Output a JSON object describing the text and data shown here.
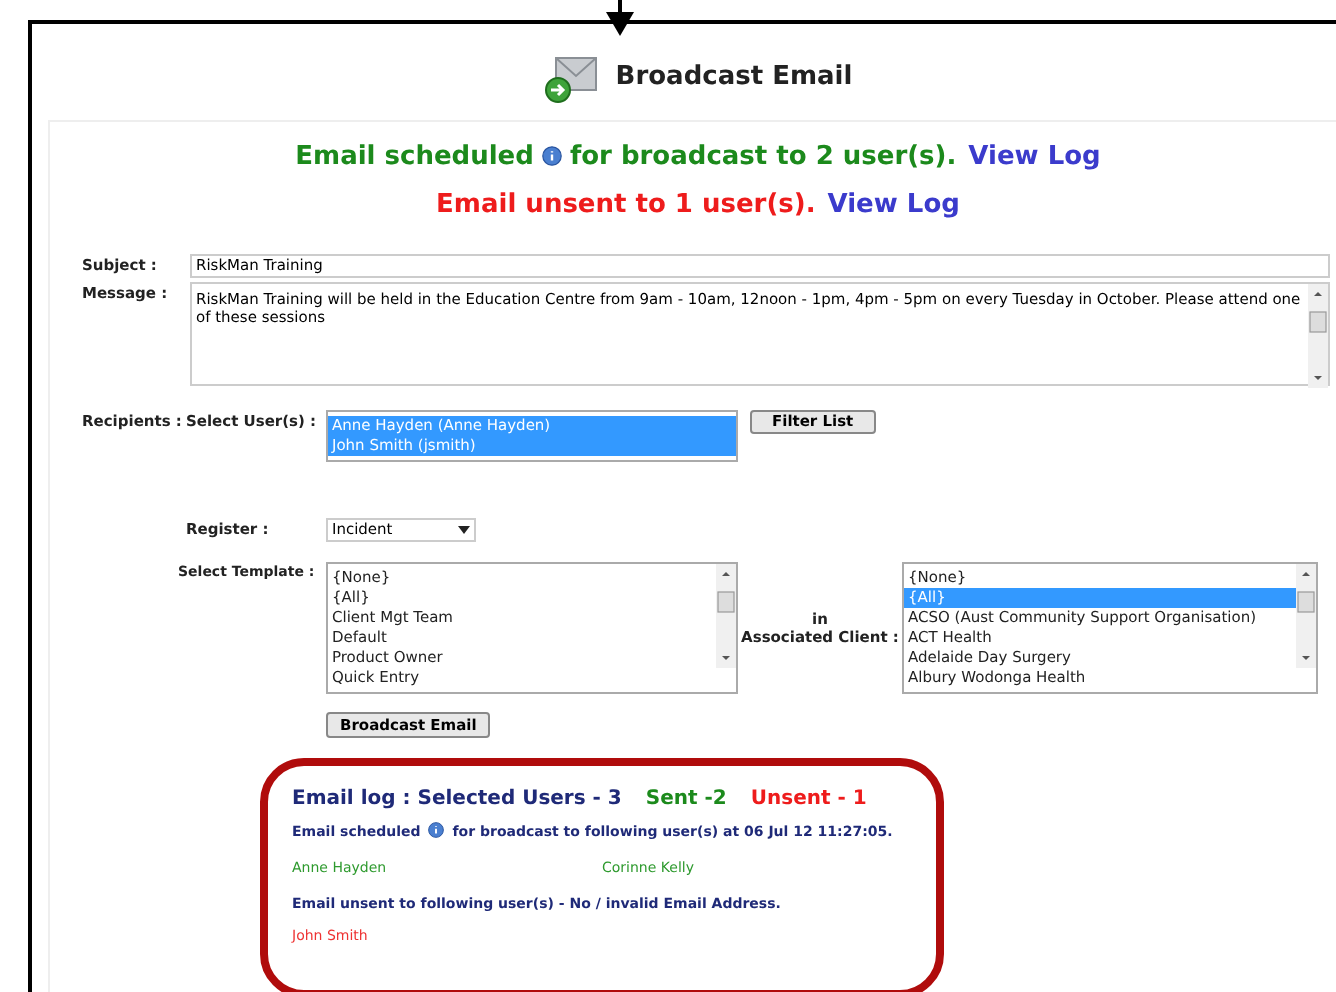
{
  "title": "Broadcast Email",
  "notices": [
    {
      "kind": "success",
      "before": "Email scheduled",
      "after": "for broadcast to 2 user(s).",
      "link": "View Log"
    },
    {
      "kind": "error",
      "before": "Email unsent to 1 user(s).",
      "link": "View Log"
    }
  ],
  "subject": {
    "label": "Subject :",
    "value": "RiskMan Training"
  },
  "message": {
    "label": "Message :",
    "value": "RiskMan Training will be held in the Education Centre from 9am - 10am, 12noon - 1pm, 4pm - 5pm on every Tuesday in October. Please attend one of these sessions"
  },
  "recipients": {
    "label": "Recipients :",
    "select_label": "Select User(s) :",
    "users": [
      {
        "label": "Anne Hayden (Anne Hayden)",
        "selected": true
      },
      {
        "label": "John Smith (jsmith)",
        "selected": true
      }
    ],
    "filter_button": "Filter List"
  },
  "register": {
    "label": "Register :",
    "value": "Incident"
  },
  "template": {
    "label": "Select Template :",
    "items": [
      {
        "label": "{None}",
        "selected": false
      },
      {
        "label": "{All}",
        "selected": false
      },
      {
        "label": "Client Mgt Team",
        "selected": false
      },
      {
        "label": "Default",
        "selected": false
      },
      {
        "label": "Product Owner",
        "selected": false
      },
      {
        "label": "Quick Entry",
        "selected": false
      }
    ]
  },
  "client": {
    "label_top": "in",
    "label": "Associated Client :",
    "items": [
      {
        "label": "{None}",
        "selected": false
      },
      {
        "label": "{All}",
        "selected": true
      },
      {
        "label": "ACSO (Aust Community Support Organisation)",
        "selected": false
      },
      {
        "label": "ACT Health",
        "selected": false
      },
      {
        "label": "Adelaide Day Surgery",
        "selected": false
      },
      {
        "label": "Albury Wodonga Health",
        "selected": false
      }
    ]
  },
  "broadcast_button": "Broadcast Email",
  "log": {
    "heading": "Email log : Selected Users - 3",
    "sent": "Sent -2",
    "unsent": "Unsent - 1",
    "scheduled_before": "Email scheduled",
    "scheduled_after": "for broadcast to following user(s) at 06 Jul 12 11:27:05.",
    "sent_users": [
      "Anne Hayden",
      "Corinne Kelly"
    ],
    "unsent_text": "Email unsent to following user(s) - No / invalid Email Address.",
    "unsent_users": [
      "John Smith"
    ]
  }
}
